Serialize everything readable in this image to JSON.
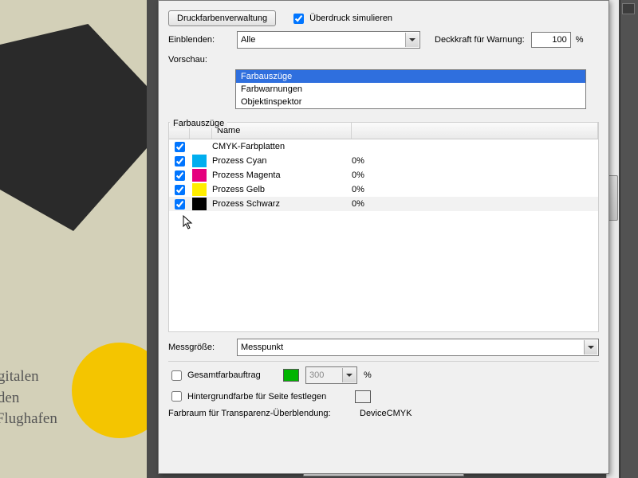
{
  "toolbar": {
    "ink_manager_label": "Druckfarbenverwaltung",
    "simulate_overprint_label": "Überdruck simulieren"
  },
  "show_row": {
    "label": "Einblenden:",
    "select_value": "Alle",
    "opacity_label": "Deckkraft für Warnung:",
    "opacity_value": "100",
    "opacity_unit": "%"
  },
  "preview_row": {
    "label": "Vorschau:",
    "options": [
      "Farbauszüge",
      "Farbwarnungen",
      "Objektinspektor"
    ]
  },
  "separations": {
    "group_label": "Farbauszüge",
    "columns": {
      "name": "Name"
    },
    "rows": [
      {
        "checked": true,
        "swatch": "",
        "name": "CMYK-Farbplatten",
        "pct": ""
      },
      {
        "checked": true,
        "swatch": "#00AEEF",
        "name": "Prozess Cyan",
        "pct": "0%"
      },
      {
        "checked": true,
        "swatch": "#E5007E",
        "name": "Prozess Magenta",
        "pct": "0%"
      },
      {
        "checked": true,
        "swatch": "#FFED00",
        "name": "Prozess Gelb",
        "pct": "0%"
      },
      {
        "checked": true,
        "swatch": "#000000",
        "name": "Prozess Schwarz",
        "pct": "0%"
      }
    ]
  },
  "sample": {
    "label": "Messgröße:",
    "value": "Messpunkt"
  },
  "total_ink": {
    "label": "Gesamtfarbauftrag",
    "chip_color": "#00b400",
    "value": "300",
    "unit": "%"
  },
  "bg_color": {
    "label": "Hintergrundfarbe für Seite festlegen"
  },
  "blend_space": {
    "label": "Farbraum für Transparenz-Überblendung:",
    "value": "DeviceCMYK"
  },
  "bg_text_lines": [
    "s digitalen",
    "für den",
    "ter Flughafen"
  ]
}
